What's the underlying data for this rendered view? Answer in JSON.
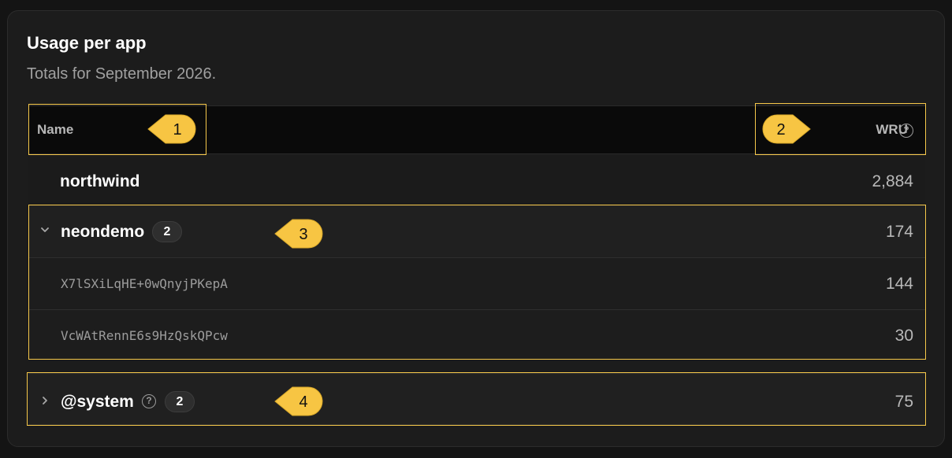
{
  "card": {
    "title": "Usage per app",
    "subtitle": "Totals for September 2026."
  },
  "table": {
    "col_name": "Name",
    "col_wru": "WRU",
    "help_glyph": "?"
  },
  "rows": {
    "northwind": {
      "name": "northwind",
      "value": "2,884"
    },
    "neondemo": {
      "name": "neondemo",
      "count": "2",
      "value": "174",
      "expanded": true,
      "children": [
        {
          "name": "X7lSXiLqHE+0wQnyjPKepA",
          "value": "144"
        },
        {
          "name": "VcWAtRennE6s9HzQskQPcw",
          "value": "30"
        }
      ]
    },
    "system": {
      "name": "@system",
      "count": "2",
      "value": "75",
      "expanded": false
    }
  },
  "callouts": [
    "1",
    "2",
    "3",
    "4"
  ],
  "colors": {
    "background": "#141414",
    "card": "#1c1c1c",
    "header": "#0a0a0a",
    "highlight": "#f6c84a",
    "callout_fill": "#f7c543"
  },
  "icons": {
    "chevron_down": "chevron-down-icon",
    "chevron_right": "chevron-right-icon",
    "help": "help-circle-icon"
  }
}
